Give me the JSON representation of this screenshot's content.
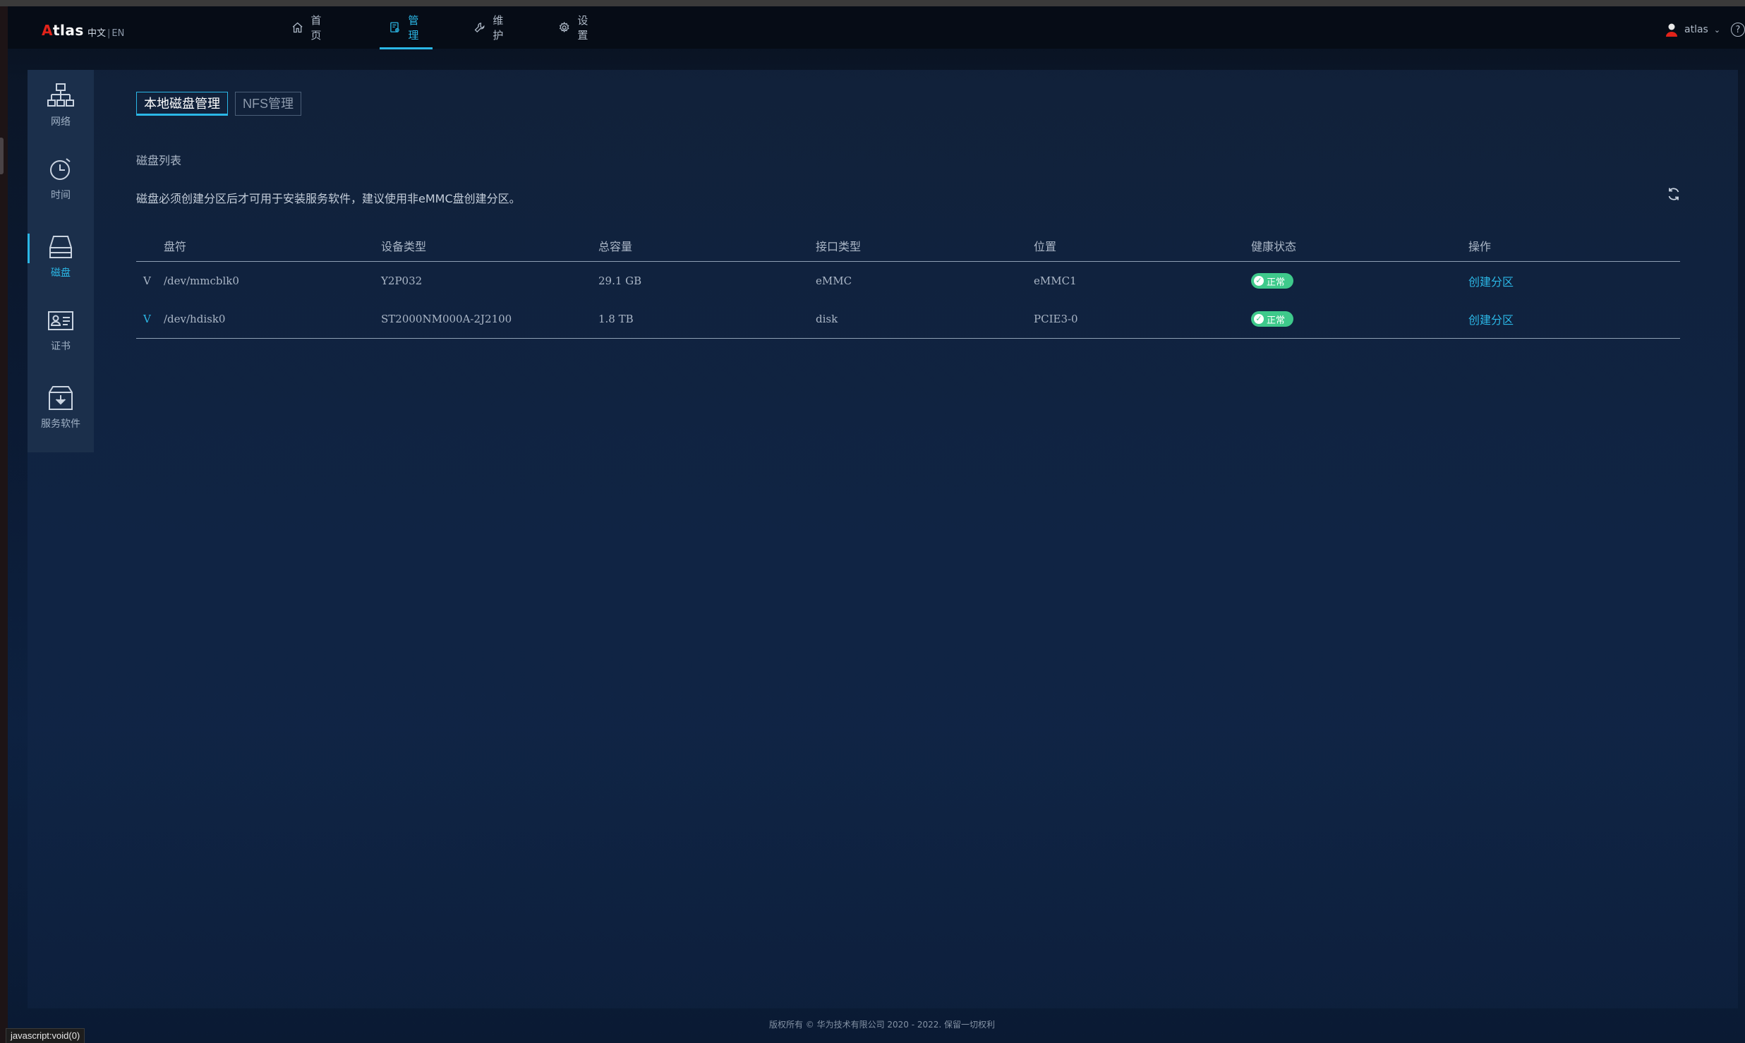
{
  "header": {
    "brand_a": "A",
    "brand_rest": "tlas",
    "lang_zh": "中文",
    "lang_sep": "|",
    "lang_en": "EN",
    "nav": [
      {
        "label": "首页",
        "icon": "home-icon"
      },
      {
        "label": "管理",
        "icon": "manage-icon",
        "active": true
      },
      {
        "label": "维护",
        "icon": "wrench-icon"
      },
      {
        "label": "设置",
        "icon": "gear-icon"
      }
    ],
    "user": "atlas",
    "help": "?"
  },
  "sidebar": {
    "items": [
      {
        "label": "网络",
        "icon": "network-icon"
      },
      {
        "label": "时间",
        "icon": "clock-icon"
      },
      {
        "label": "磁盘",
        "icon": "disk-icon",
        "active": true
      },
      {
        "label": "证书",
        "icon": "certificate-icon"
      },
      {
        "label": "服务软件",
        "icon": "download-box-icon"
      }
    ]
  },
  "content": {
    "tabs": [
      "本地磁盘管理",
      "NFS管理"
    ],
    "section_title": "磁盘列表",
    "hint": "磁盘必须创建分区后才可用于安装服务软件，建议使用非eMMC盘创建分区。",
    "table": {
      "headers": [
        "盘符",
        "设备类型",
        "总容量",
        "接口类型",
        "位置",
        "健康状态",
        "操作"
      ],
      "rows": [
        {
          "expand": "V",
          "drive": "/dev/mmcblk0",
          "device_type": "Y2P032",
          "capacity": "29.1 GB",
          "interface": "eMMC",
          "location": "eMMC1",
          "health": "正常",
          "action": "创建分区"
        },
        {
          "expand": "V",
          "drive": "/dev/hdisk0",
          "device_type": "ST2000NM000A-2J2100",
          "capacity": "1.8 TB",
          "interface": "disk",
          "location": "PCIE3-0",
          "health": "正常",
          "action": "创建分区"
        }
      ]
    }
  },
  "footer": "版权所有 © 华为技术有限公司 2020 - 2022. 保留一切权利",
  "statusbar": "javascript:void(0)",
  "colors": {
    "accent": "#2bb7e6",
    "healthy": "#3ec98b",
    "brand_red": "#e2231a"
  }
}
